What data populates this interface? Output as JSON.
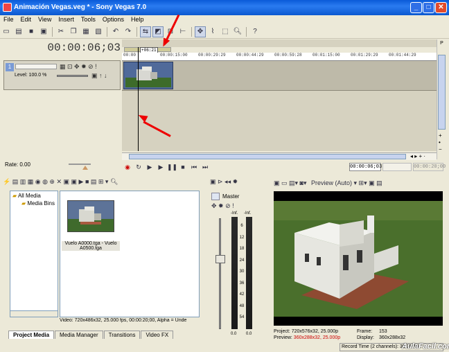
{
  "window": {
    "title": "Animación Vegas.veg * - Sony Vegas 7.0"
  },
  "menu": [
    "File",
    "Edit",
    "View",
    "Insert",
    "Tools",
    "Options",
    "Help"
  ],
  "timeline": {
    "timecode": "00:00:06;03",
    "loop_label": "+06:21",
    "ruler_ticks": [
      "00:00",
      "00:00:15:00",
      "00:00:29:29",
      "00:00:44:29",
      "00:00:59:28",
      "00:01:15:00",
      "00:01:29:29",
      "00:01:44:29"
    ],
    "track": {
      "number": "1",
      "level_label": "Level: 100.0 %"
    },
    "rate_label": "Rate: 0.00",
    "cursor_time": "00:00:06;03",
    "end_time": "00:00:20;00"
  },
  "media": {
    "tree": [
      "All Media",
      "Media Bins"
    ],
    "item_name": "Vuelo A0000.tga - Vuelo A0500.tga",
    "info": "Video: 720x486x32, 25.000 fps, 00:00:20;00, Alpha = Unde"
  },
  "tabs": [
    "Project Media",
    "Media Manager",
    "Transitions",
    "Video FX"
  ],
  "mixer": {
    "label": "Master",
    "inf_left": "-Inf.",
    "inf_right": "-Inf.",
    "scale": [
      "6",
      "12",
      "18",
      "24",
      "30",
      "36",
      "42",
      "48",
      "54"
    ],
    "value_left": "0.0",
    "value_right": "0.0"
  },
  "preview": {
    "mode": "Preview (Auto)",
    "project_label": "Project:",
    "project_value": "720x576x32, 25.000p",
    "preview_label": "Preview:",
    "preview_value": "360x288x32, 25.000p",
    "frame_label": "Frame:",
    "frame_value": "153",
    "display_label": "Display:",
    "display_value": "360x288x32"
  },
  "status": {
    "record_time": "Record Time (2 channels): 38:25:10"
  },
  "watermark": "AulaFacil.com"
}
